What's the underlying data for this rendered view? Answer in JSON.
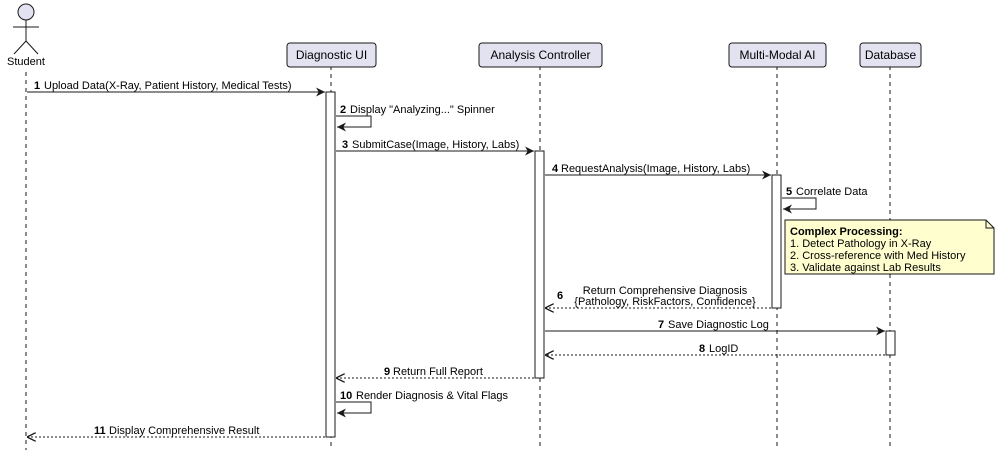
{
  "actor": {
    "label": "Student"
  },
  "participants": [
    {
      "label": "Diagnostic UI"
    },
    {
      "label": "Analysis Controller"
    },
    {
      "label": "Multi-Modal AI"
    },
    {
      "label": "Database"
    }
  ],
  "messages": [
    {
      "num": "1",
      "text": "Upload Data(X-Ray, Patient History, Medical Tests)"
    },
    {
      "num": "2",
      "text": "Display \"Analyzing...\" Spinner"
    },
    {
      "num": "3",
      "text": "SubmitCase(Image, History, Labs)"
    },
    {
      "num": "4",
      "text": "RequestAnalysis(Image, History, Labs)"
    },
    {
      "num": "5",
      "text": "Correlate Data"
    },
    {
      "num": "6",
      "line1": "Return Comprehensive Diagnosis",
      "line2": "{Pathology, RiskFactors, Confidence}"
    },
    {
      "num": "7",
      "text": "Save Diagnostic Log"
    },
    {
      "num": "8",
      "text": "LogID"
    },
    {
      "num": "9",
      "text": "Return Full Report"
    },
    {
      "num": "10",
      "text": "Render Diagnosis & Vital Flags"
    },
    {
      "num": "11",
      "text": "Display Comprehensive Result"
    }
  ],
  "note": {
    "title": "Complex Processing:",
    "lines": [
      "1. Detect Pathology in X-Ray",
      "2. Cross-reference with Med History",
      "3. Validate against Lab Results"
    ]
  },
  "colors": {
    "participant_fill": "#e2e2f0",
    "participant_border": "#181818",
    "note_fill": "#fefece",
    "activation_fill": "#ffffff",
    "line": "#181818"
  }
}
